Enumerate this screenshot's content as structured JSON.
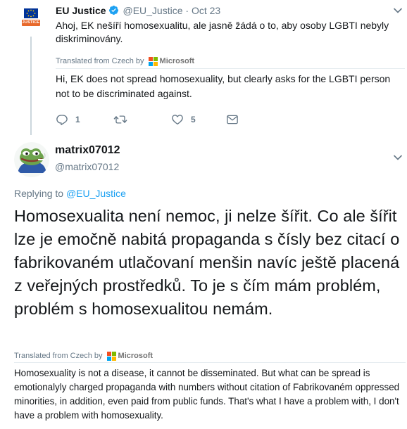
{
  "parent_tweet": {
    "avatar_label": "JUSTICE",
    "name": "EU Justice",
    "handle": "@EU_Justice",
    "separator": "·",
    "time": "Oct 23",
    "text": "Ahoj, EK nešíří homosexualitu, ale jasně žádá o to, aby osoby LGBTI nebyly diskriminovány.",
    "translated_from": "Translated from Czech by",
    "translator": "Microsoft",
    "translation": "Hi, EK does not spread homosexuality, but clearly asks for the LGBTI person not to be discriminated against.",
    "actions": {
      "reply_count": "1",
      "retweet_count": "",
      "like_count": "5"
    }
  },
  "main_tweet": {
    "name": "matrix07012",
    "handle": "@matrix07012",
    "replying_prefix": "Replying to ",
    "replying_to": "@EU_Justice",
    "text": "Homosexualita není nemoc, ji nelze šířit. Co ale šířit lze je emočně nabitá propaganda s čísly bez citací o fabrikovaném utlačovaní menšin navíc ještě placená z veřejných prostředků. To je s čím mám problém, problém s homosexualitou nemám.",
    "translated_from": "Translated from Czech by",
    "translator": "Microsoft",
    "translation": "Homosexuality is not a disease, it cannot be disseminated. But what can be spread is emotionalyly charged propaganda with numbers without citation of Fabrikovaném oppressed minorities, in addition, even paid from public funds. That's what I have a problem with, I don't have a problem with homosexuality."
  },
  "colors": {
    "link": "#1da1f2",
    "secondary_text": "#657786",
    "eu_blue": "#003399",
    "eu_gold": "#ffcc00",
    "justice_orange": "#e8692b"
  },
  "icons": [
    "verified-badge-icon",
    "chevron-down-icon",
    "reply-icon",
    "retweet-icon",
    "like-icon",
    "dm-icon",
    "microsoft-logo-icon"
  ]
}
